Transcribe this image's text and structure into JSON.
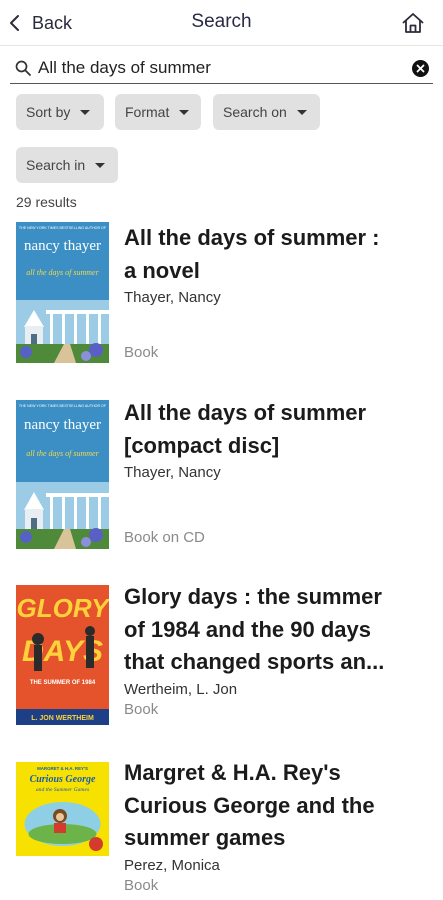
{
  "header": {
    "back_label": "Back",
    "title": "Search"
  },
  "search": {
    "value": "All the days of summer"
  },
  "filters": [
    {
      "label": "Sort by"
    },
    {
      "label": "Format"
    },
    {
      "label": "Search on"
    },
    {
      "label": "Search in"
    }
  ],
  "results_count": "29 results",
  "results": [
    {
      "title_lines": [
        "All the days of summer :",
        "a novel"
      ],
      "author": "Thayer, Nancy",
      "format": "Book",
      "cover": {
        "author": "nancy thayer",
        "title": "all the days of summer",
        "tagline": "THE NEW YORK TIMES BESTSELLING AUTHOR OF",
        "colors": {
          "sky": "#3b8fc4",
          "text": "#ffffff",
          "accent": "#f4d84a"
        }
      }
    },
    {
      "title_lines": [
        "All the days of summer",
        "[compact disc]"
      ],
      "author": "Thayer, Nancy",
      "format": "Book on CD",
      "cover": {
        "author": "nancy thayer",
        "title": "all the days of summer",
        "tagline": "THE NEW YORK TIMES BESTSELLING AUTHOR OF",
        "colors": {
          "sky": "#3b8fc4",
          "text": "#ffffff",
          "accent": "#f4d84a"
        }
      }
    },
    {
      "title_lines": [
        "Glory days : the summer",
        "of 1984 and the 90 days",
        "that changed sports an..."
      ],
      "author": "Wertheim, L. Jon",
      "format": "Book",
      "cover": {
        "title_top": "GLORY",
        "title_bottom": "DAYS",
        "subtitle": "THE SUMMER OF 1984",
        "author": "L. JON WERTHEIM",
        "colors": {
          "bg": "#e4532c",
          "text": "#ffd23c",
          "band": "#1d3f86"
        }
      }
    },
    {
      "title_lines": [
        "Margret & H.A. Rey's",
        "Curious George and the",
        "summer games"
      ],
      "author": "Perez, Monica",
      "format": "Book",
      "cover": {
        "header": "MARGRET & H.A. REY'S",
        "title": "Curious George",
        "subtitle": "and the Summer Games",
        "colors": {
          "bg": "#f6e100",
          "text": "#1a5cae"
        }
      }
    }
  ]
}
